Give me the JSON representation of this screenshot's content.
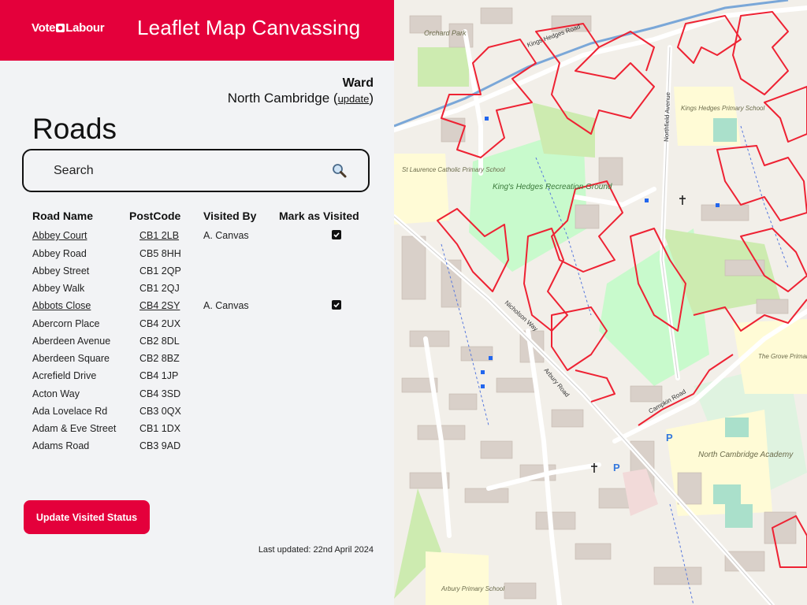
{
  "header": {
    "brand": "Vote Labour",
    "brand_first": "Vote",
    "brand_second": "Labour",
    "title": "Leaflet Map Canvassing"
  },
  "ward": {
    "label": "Ward",
    "name": "North Cambridge",
    "update_link": "update"
  },
  "roads": {
    "title": "Roads",
    "search_placeholder": "Search",
    "columns": {
      "name": "Road Name",
      "postcode": "PostCode",
      "visited_by": "Visited By",
      "mark": "Mark as Visited"
    },
    "rows": [
      {
        "name": "Abbey Court",
        "postcode": "CB1 2LB",
        "visited_by": "A. Canvas",
        "visited": true
      },
      {
        "name": "Abbey Road",
        "postcode": "CB5 8HH",
        "visited_by": "",
        "visited": false
      },
      {
        "name": "Abbey Street",
        "postcode": "CB1 2QP",
        "visited_by": "",
        "visited": false
      },
      {
        "name": "Abbey Walk",
        "postcode": "CB1 2QJ",
        "visited_by": "",
        "visited": false
      },
      {
        "name": "Abbots Close",
        "postcode": "CB4 2SY",
        "visited_by": "A. Canvas",
        "visited": true
      },
      {
        "name": "Abercorn Place",
        "postcode": "CB4 2UX",
        "visited_by": "",
        "visited": false
      },
      {
        "name": "Aberdeen Avenue",
        "postcode": "CB2 8DL",
        "visited_by": "",
        "visited": false
      },
      {
        "name": "Aberdeen Square",
        "postcode": "CB2 8BZ",
        "visited_by": "",
        "visited": false
      },
      {
        "name": "Acrefield Drive",
        "postcode": "CB4 1JP",
        "visited_by": "",
        "visited": false
      },
      {
        "name": "Acton Way",
        "postcode": "CB4 3SD",
        "visited_by": "",
        "visited": false
      },
      {
        "name": "Ada Lovelace Rd",
        "postcode": "CB3 0QX",
        "visited_by": "",
        "visited": false
      },
      {
        "name": "Adam & Eve Street",
        "postcode": "CB1 1DX",
        "visited_by": "",
        "visited": false
      },
      {
        "name": "Adams Road",
        "postcode": "CB3 9AD",
        "visited_by": "",
        "visited": false
      }
    ]
  },
  "actions": {
    "update_button": "Update Visited Status"
  },
  "footer": {
    "last_updated": "Last updated:  22nd April 2024"
  },
  "map": {
    "labels": {
      "kings_hedges_road": "Kings Hedges Road",
      "orchard_park": "Orchard Park",
      "recreation_ground": "King's Hedges Recreation Ground",
      "st_laurence": "St Laurence Catholic Primary School",
      "kings_hedges_school": "Kings Hedges Primary School",
      "grove_school": "The Grove Primary School",
      "nca": "North Cambridge Academy",
      "arbury_road": "Arbury Road",
      "nicholson_way": "Nicholson Way",
      "northfield_avenue": "Northfield Avenue",
      "campkin_road": "Campkin Road",
      "arbury_primary": "Arbury Primary School"
    }
  },
  "colors": {
    "brand_red": "#e4003b",
    "route_red": "#ee2233",
    "park_green": "#c8facc",
    "school_yellow": "#fffbd6",
    "building": "#d9d0c9"
  }
}
